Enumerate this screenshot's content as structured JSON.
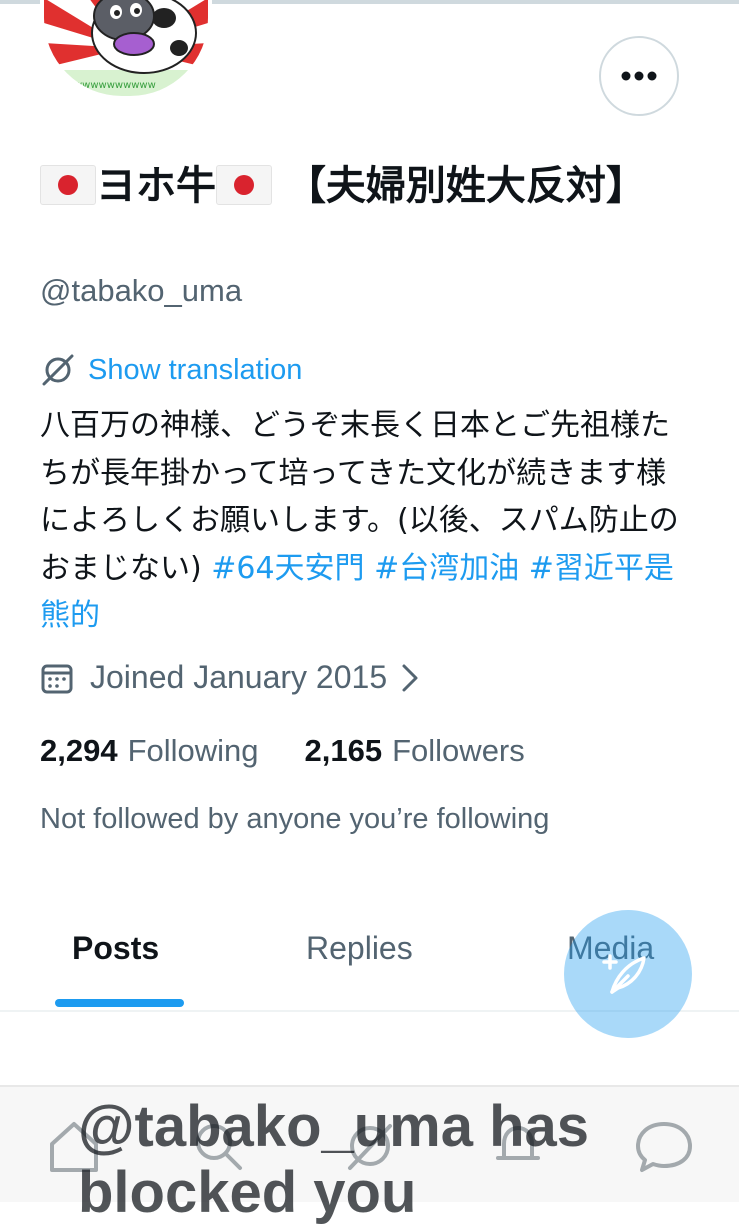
{
  "profile": {
    "name_main": "ヨホ牛",
    "name_suffix": "【夫婦別姓大反対】",
    "handle": "@tabako_uma",
    "translate_label": "Show translation",
    "bio_text": "八百万の神様、どうぞ末長く日本とご先祖様たちが長年掛かって培ってきた文化が続きます様によろしくお願いします。(以後、スパム防止のおまじない) ",
    "bio_hashtags": [
      "#64天安門",
      "#台湾加油",
      "#習近平是熊的"
    ],
    "joined": "Joined January 2015",
    "following_count": "2,294",
    "following_label": "Following",
    "followers_count": "2,165",
    "followers_label": "Followers",
    "not_followed_text": "Not followed by anyone you’re following"
  },
  "tabs": [
    {
      "label": "Posts",
      "active": true
    },
    {
      "label": "Replies",
      "active": false
    },
    {
      "label": "Media",
      "active": false
    }
  ],
  "blocked_message": "@tabako_uma has blocked you",
  "icons": {
    "more": "more-horizontal-icon",
    "translate": "translate-icon",
    "calendar": "calendar-icon",
    "chevron": "chevron-right-icon",
    "compose": "compose-feather-icon",
    "nav": [
      "home-icon",
      "search-icon",
      "grok-icon",
      "notifications-icon",
      "messages-icon"
    ]
  },
  "colors": {
    "accent": "#1d9bf0",
    "text_primary": "#0f1419",
    "text_secondary": "#536471",
    "flag_red": "#d9232e"
  }
}
